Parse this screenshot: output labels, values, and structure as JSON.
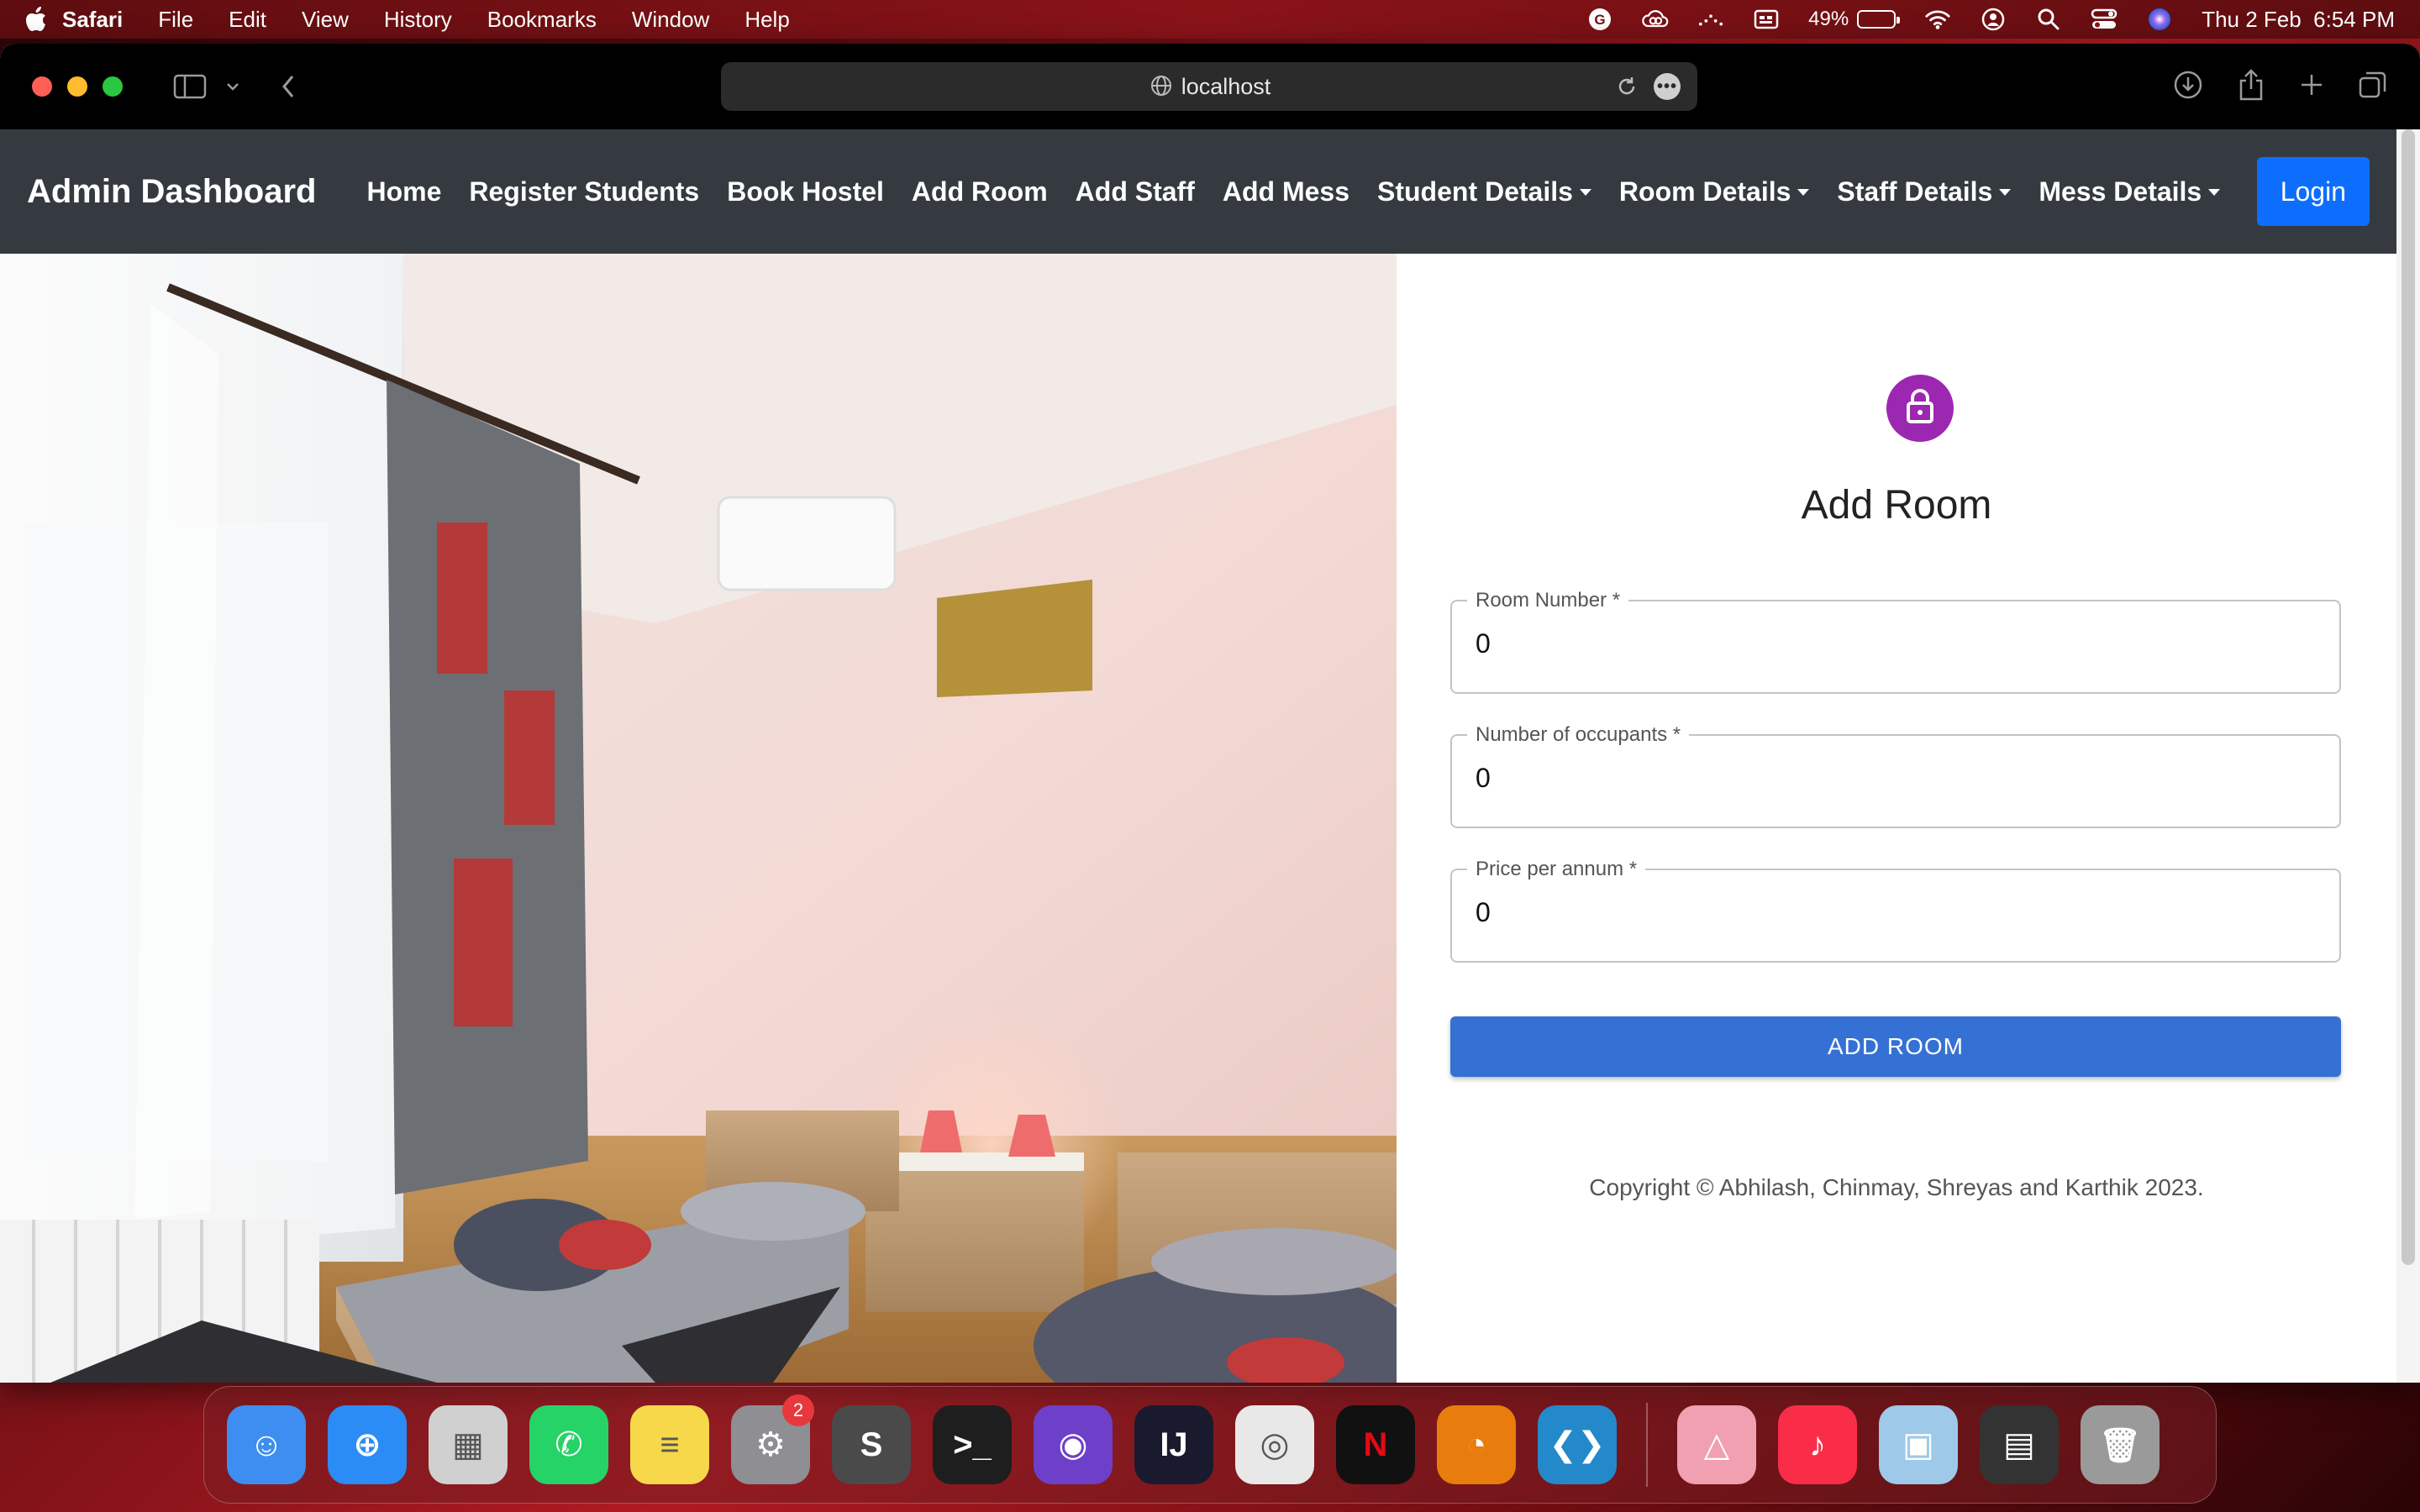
{
  "menubar": {
    "app_name": "Safari",
    "items": [
      "File",
      "Edit",
      "View",
      "History",
      "Bookmarks",
      "Window",
      "Help"
    ],
    "battery_percent": "49%",
    "battery_level": 0.49,
    "datetime": "Thu 2 Feb  6:54 PM"
  },
  "browser": {
    "url": "localhost"
  },
  "navbar": {
    "brand": "Admin Dashboard",
    "links": [
      "Home",
      "Register Students",
      "Book Hostel",
      "Add Room",
      "Add Staff",
      "Add Mess"
    ],
    "dropdowns": [
      "Student Details",
      "Room Details",
      "Staff Details",
      "Mess Details"
    ],
    "login_label": "Login"
  },
  "form": {
    "title": "Add Room",
    "fields": [
      {
        "label": "Room Number *",
        "value": "0"
      },
      {
        "label": "Number of occupants *",
        "value": "0"
      },
      {
        "label": "Price per annum *",
        "value": "0"
      }
    ],
    "submit_label": "ADD ROOM",
    "copyright": "Copyright © Abhilash, Chinmay, Shreyas and Karthik 2023."
  },
  "dock": {
    "apps": [
      {
        "name": "Finder",
        "icon": "finder-icon",
        "color": "#3d8ef0"
      },
      {
        "name": "Safari",
        "icon": "safari-icon",
        "color": "#2a8cf4"
      },
      {
        "name": "Launchpad",
        "icon": "launchpad-icon",
        "color": "#d0d0d0"
      },
      {
        "name": "WhatsApp",
        "icon": "whatsapp-icon",
        "color": "#25d366"
      },
      {
        "name": "Notes",
        "icon": "notes-icon",
        "color": "#f6d84a"
      },
      {
        "name": "System Settings",
        "icon": "settings-icon",
        "color": "#8e8e93",
        "badge": "2"
      },
      {
        "name": "Sublime Text",
        "icon": "sublime-icon",
        "color": "#4a4a4a"
      },
      {
        "name": "Terminal",
        "icon": "terminal-icon",
        "color": "#1e1e1e"
      },
      {
        "name": "GitHub Desktop",
        "icon": "github-icon",
        "color": "#6e40c9"
      },
      {
        "name": "IntelliJ IDEA",
        "icon": "intellij-icon",
        "color": "#1a1a2e"
      },
      {
        "name": "Chrome",
        "icon": "chrome-icon",
        "color": "#e8e8e8"
      },
      {
        "name": "Netflix",
        "icon": "netflix-icon",
        "color": "#111111"
      },
      {
        "name": "Blender",
        "icon": "blender-icon",
        "color": "#e87d0d"
      },
      {
        "name": "VS Code",
        "icon": "vscode-icon",
        "color": "#2489ca"
      }
    ],
    "apps_right": [
      {
        "name": "Affinity",
        "icon": "affinity-icon",
        "color": "#f0a0b0"
      },
      {
        "name": "Music",
        "icon": "music-icon",
        "color": "#fa2d48"
      },
      {
        "name": "Preview",
        "icon": "preview-icon",
        "color": "#9ec9e8"
      },
      {
        "name": "WhatsApp Window",
        "icon": "window-thumbnail-icon",
        "color": "#333333"
      },
      {
        "name": "Trash",
        "icon": "trash-icon",
        "color": "#9a9a9a"
      }
    ]
  }
}
